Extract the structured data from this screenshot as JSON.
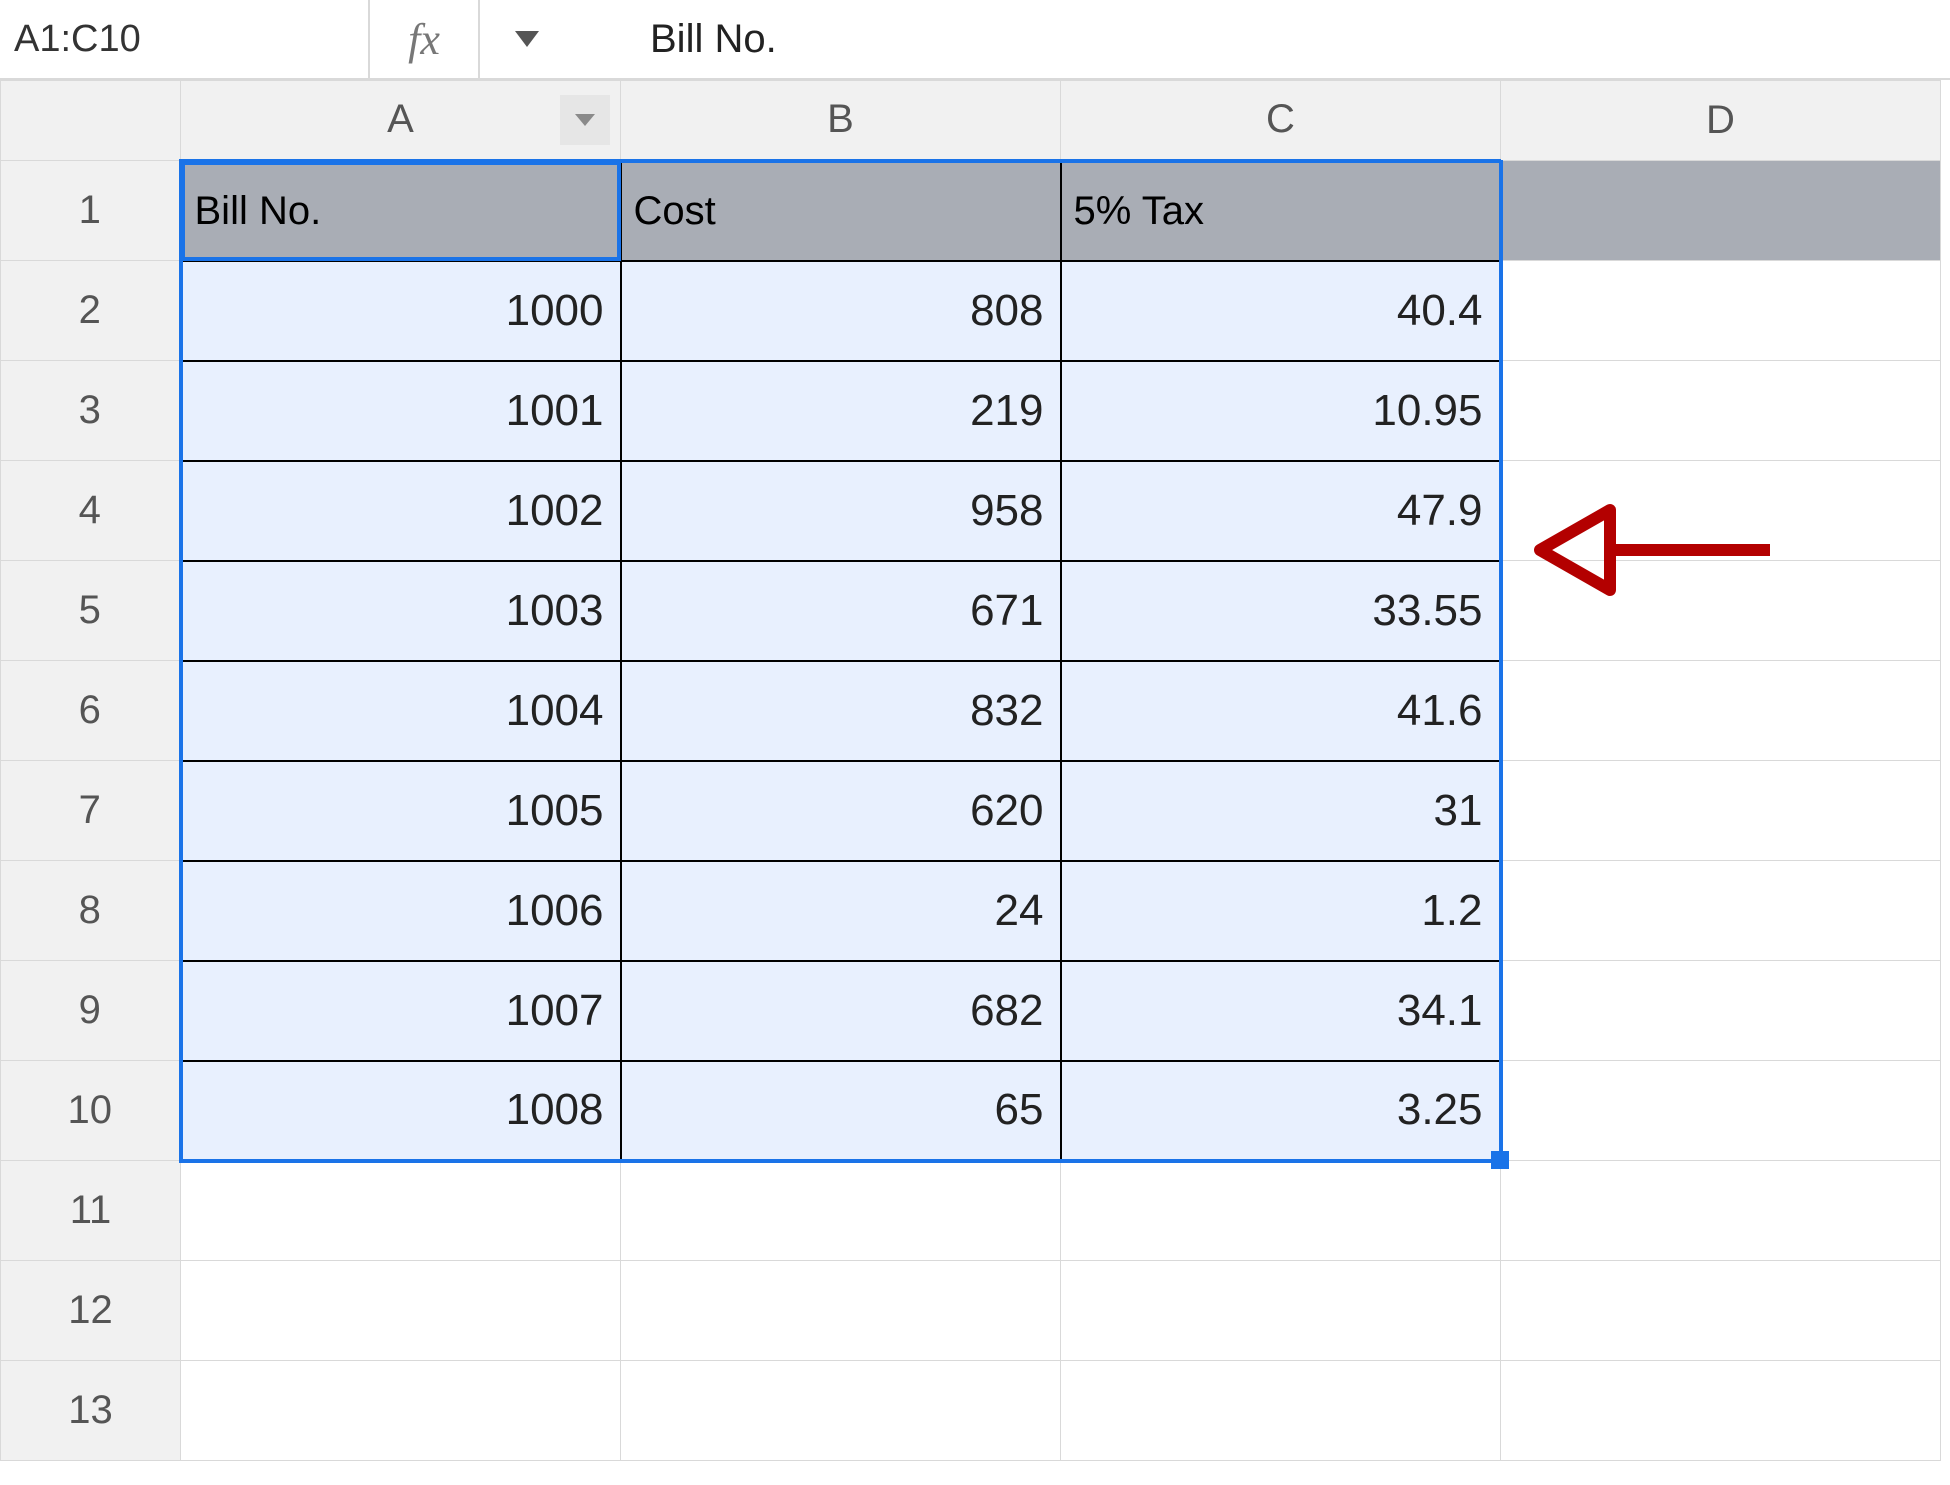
{
  "formula_bar": {
    "name_box": "A1:C10",
    "fx_label": "fx",
    "formula_value": "Bill No."
  },
  "columns": [
    "A",
    "B",
    "C",
    "D"
  ],
  "row_numbers": [
    1,
    2,
    3,
    4,
    5,
    6,
    7,
    8,
    9,
    10,
    11,
    12,
    13
  ],
  "headers": {
    "A": "Bill No.",
    "B": "Cost",
    "C": "5% Tax"
  },
  "rows": [
    {
      "A": "1000",
      "B": "808",
      "C": "40.4"
    },
    {
      "A": "1001",
      "B": "219",
      "C": "10.95"
    },
    {
      "A": "1002",
      "B": "958",
      "C": "47.9"
    },
    {
      "A": "1003",
      "B": "671",
      "C": "33.55"
    },
    {
      "A": "1004",
      "B": "832",
      "C": "41.6"
    },
    {
      "A": "1005",
      "B": "620",
      "C": "31"
    },
    {
      "A": "1006",
      "B": "24",
      "C": "1.2"
    },
    {
      "A": "1007",
      "B": "682",
      "C": "34.1"
    },
    {
      "A": "1008",
      "B": "65",
      "C": "3.25"
    }
  ],
  "selection": {
    "range": "A1:C10",
    "active": "A1"
  },
  "annotation": {
    "arrow_points_to_row": 4,
    "color": "#b30000"
  },
  "chart_data": {
    "type": "table",
    "title": "",
    "columns": [
      "Bill No.",
      "Cost",
      "5% Tax"
    ],
    "data": [
      [
        1000,
        808,
        40.4
      ],
      [
        1001,
        219,
        10.95
      ],
      [
        1002,
        958,
        47.9
      ],
      [
        1003,
        671,
        33.55
      ],
      [
        1004,
        832,
        41.6
      ],
      [
        1005,
        620,
        31
      ],
      [
        1006,
        24,
        1.2
      ],
      [
        1007,
        682,
        34.1
      ],
      [
        1008,
        65,
        3.25
      ]
    ]
  }
}
